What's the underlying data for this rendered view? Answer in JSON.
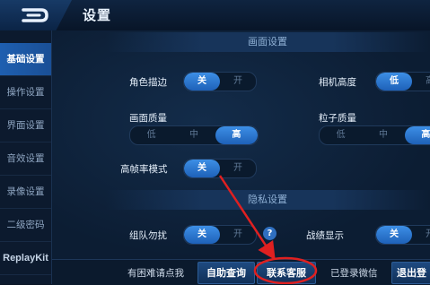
{
  "header": {
    "title": "设置",
    "back_icon": "back-arrow-icon"
  },
  "sidebar": {
    "items": [
      {
        "label": "基础设置",
        "active": true
      },
      {
        "label": "操作设置"
      },
      {
        "label": "界面设置"
      },
      {
        "label": "音效设置"
      },
      {
        "label": "录像设置"
      },
      {
        "label": "二级密码"
      },
      {
        "label": "ReplayKit"
      }
    ]
  },
  "sections": {
    "display": "画面设置",
    "privacy": "隐私设置"
  },
  "settings": {
    "outline": {
      "label": "角色描边",
      "options": [
        "关",
        "开"
      ],
      "selected": "关"
    },
    "camera": {
      "label": "相机高度",
      "options": [
        "低",
        "高"
      ],
      "selected": "低"
    },
    "quality": {
      "label": "画面质量",
      "options": [
        "低",
        "中",
        "高"
      ],
      "selected": "高"
    },
    "particle": {
      "label": "粒子质量",
      "options": [
        "低",
        "中",
        "高"
      ],
      "selected": "高"
    },
    "highfps": {
      "label": "高帧率模式",
      "options": [
        "关",
        "开"
      ],
      "selected": "关"
    },
    "team": {
      "label": "组队勿扰",
      "options": [
        "关",
        "开"
      ],
      "selected": "关"
    },
    "record": {
      "label": "战绩显示",
      "options": [
        "关",
        "开"
      ],
      "selected": "关"
    }
  },
  "footer": {
    "help_text": "有困难请点我",
    "self_service": "自助查询",
    "contact": "联系客服",
    "wechat": "已登录微信",
    "logout": "退出登"
  },
  "colors": {
    "accent": "#1e61b8",
    "annotation": "#e02020"
  }
}
